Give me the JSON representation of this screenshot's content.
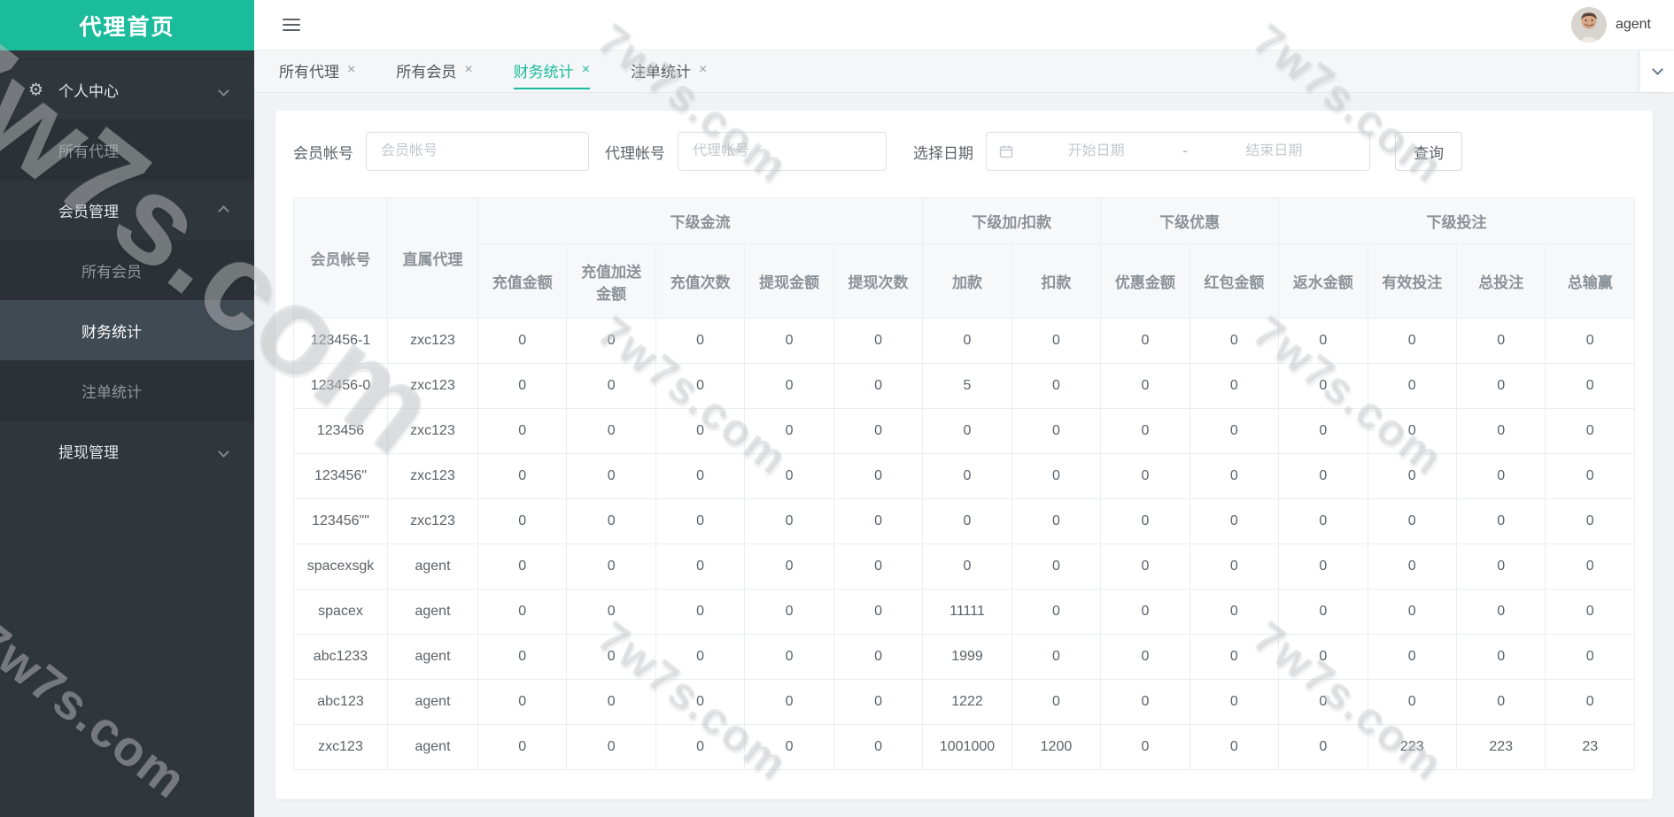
{
  "colors": {
    "brand": "#1abc9c",
    "sidebar_bg": "#2f363c",
    "active_item_bg": "#404a52"
  },
  "sidebar": {
    "title": "代理首页",
    "items": [
      {
        "name": "personal-center",
        "label": "个人中心",
        "type": "top",
        "icon": "gear-icon",
        "chevron": "down"
      },
      {
        "name": "all-agents",
        "label": "所有代理",
        "type": "sub"
      },
      {
        "name": "member-management",
        "label": "会员管理",
        "type": "top",
        "chevron": "up"
      },
      {
        "name": "all-members",
        "label": "所有会员",
        "type": "sub2"
      },
      {
        "name": "finance-statistics",
        "label": "财务统计",
        "type": "sub2",
        "active": true
      },
      {
        "name": "bet-statistics",
        "label": "注单统计",
        "type": "sub2"
      },
      {
        "name": "withdraw-management",
        "label": "提现管理",
        "type": "top",
        "chevron": "down"
      }
    ]
  },
  "topbar": {
    "username": "agent"
  },
  "tabs": [
    {
      "name": "all-agents",
      "label": "所有代理",
      "close": "×"
    },
    {
      "name": "all-members",
      "label": "所有会员",
      "close": "×"
    },
    {
      "name": "finance-statistics",
      "label": "财务统计",
      "close": "×",
      "active": true
    },
    {
      "name": "bet-statistics",
      "label": "注单统计",
      "close": "×"
    }
  ],
  "filters": {
    "member_label": "会员帐号",
    "member_placeholder": "会员帐号",
    "agent_label": "代理帐号",
    "agent_placeholder": "代理帐号",
    "date_label": "选择日期",
    "date_start_placeholder": "开始日期",
    "date_separator": "-",
    "date_end_placeholder": "结束日期",
    "search_button": "查询"
  },
  "table": {
    "fixed_headers": [
      "会员帐号",
      "直属代理"
    ],
    "groups": [
      {
        "label": "下级金流",
        "columns": [
          "充值金额",
          "充值加送\n金额",
          "充值次数",
          "提现金额",
          "提现次数"
        ]
      },
      {
        "label": "下级加/扣款",
        "columns": [
          "加款",
          "扣款"
        ]
      },
      {
        "label": "下级优惠",
        "columns": [
          "优惠金额",
          "红包金额"
        ]
      },
      {
        "label": "下级投注",
        "columns": [
          "返水金额",
          "有效投注",
          "总投注",
          "总输赢"
        ]
      }
    ],
    "rows": [
      {
        "account": "123456-1",
        "agent": "zxc123",
        "values": [
          0,
          0,
          0,
          0,
          0,
          0,
          0,
          0,
          0,
          0,
          0,
          0,
          0
        ]
      },
      {
        "account": "123456-0",
        "agent": "zxc123",
        "values": [
          0,
          0,
          0,
          0,
          0,
          5,
          0,
          0,
          0,
          0,
          0,
          0,
          0
        ]
      },
      {
        "account": "123456",
        "agent": "zxc123",
        "values": [
          0,
          0,
          0,
          0,
          0,
          0,
          0,
          0,
          0,
          0,
          0,
          0,
          0
        ]
      },
      {
        "account": "123456\"",
        "agent": "zxc123",
        "values": [
          0,
          0,
          0,
          0,
          0,
          0,
          0,
          0,
          0,
          0,
          0,
          0,
          0
        ]
      },
      {
        "account": "123456\"\"",
        "agent": "zxc123",
        "values": [
          0,
          0,
          0,
          0,
          0,
          0,
          0,
          0,
          0,
          0,
          0,
          0,
          0
        ]
      },
      {
        "account": "spacexsgk",
        "agent": "agent",
        "values": [
          0,
          0,
          0,
          0,
          0,
          0,
          0,
          0,
          0,
          0,
          0,
          0,
          0
        ]
      },
      {
        "account": "spacex",
        "agent": "agent",
        "values": [
          0,
          0,
          0,
          0,
          0,
          11111,
          0,
          0,
          0,
          0,
          0,
          0,
          0
        ]
      },
      {
        "account": "abc1233",
        "agent": "agent",
        "values": [
          0,
          0,
          0,
          0,
          0,
          1999,
          0,
          0,
          0,
          0,
          0,
          0,
          0
        ]
      },
      {
        "account": "abc123",
        "agent": "agent",
        "values": [
          0,
          0,
          0,
          0,
          0,
          1222,
          0,
          0,
          0,
          0,
          0,
          0,
          0
        ]
      },
      {
        "account": "zxc123",
        "agent": "agent",
        "values": [
          0,
          0,
          0,
          0,
          0,
          1001000,
          1200,
          0,
          0,
          0,
          223,
          223,
          23
        ]
      }
    ]
  },
  "watermark": {
    "text": "7w7s.com"
  }
}
